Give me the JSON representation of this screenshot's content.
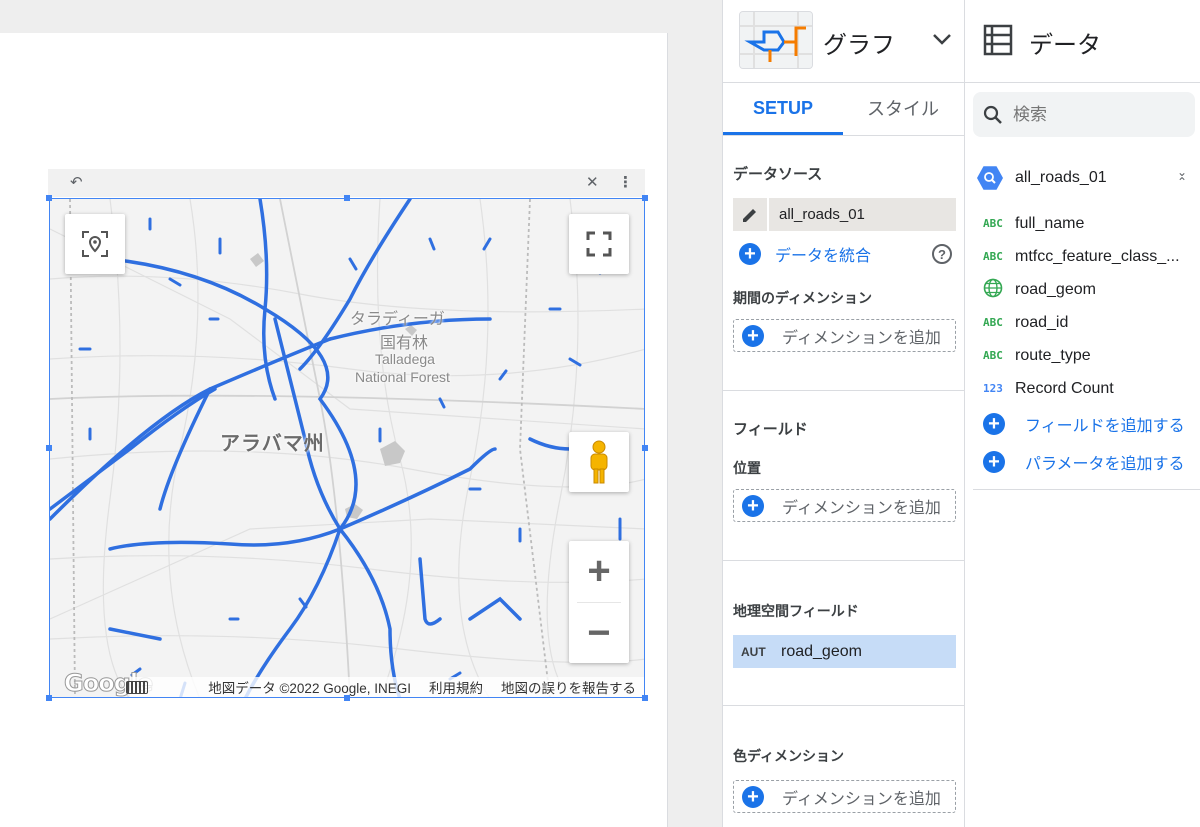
{
  "props_panel": {
    "title": "グラフ",
    "tabs": [
      {
        "label": "SETUP",
        "active": true
      },
      {
        "label": "スタイル",
        "active": false
      }
    ],
    "data_source": {
      "heading": "データソース",
      "name": "all_roads_01",
      "blend_label": "データを統合"
    },
    "date_dimension": {
      "heading": "期間のディメンション",
      "add_label": "ディメンションを追加"
    },
    "fields": {
      "heading": "フィールド",
      "location_label": "位置",
      "add_label": "ディメンションを追加"
    },
    "geo_field": {
      "heading": "地理空間フィールド",
      "type_badge": "AUT",
      "value": "road_geom"
    },
    "color_dimension": {
      "heading": "色ディメンション",
      "add_label": "ディメンションを追加"
    }
  },
  "data_panel": {
    "title": "データ",
    "search_placeholder": "検索",
    "source_name": "all_roads_01",
    "fields": [
      {
        "type": "ABC",
        "name": "full_name"
      },
      {
        "type": "ABC",
        "name": "mtfcc_feature_class_..."
      },
      {
        "type": "globe",
        "name": "road_geom"
      },
      {
        "type": "ABC",
        "name": "road_id"
      },
      {
        "type": "ABC",
        "name": "route_type"
      },
      {
        "type": "123",
        "name": "Record Count"
      }
    ],
    "add_field_label": "フィールドを追加する",
    "add_param_label": "パラメータを追加する"
  },
  "map": {
    "state_label": "アラバマ州",
    "forest_label_jp1": "タラディーガ",
    "forest_label_jp2": "国有林",
    "forest_label_en1": "Talladega",
    "forest_label_en2": "National Forest",
    "logo_text": "Google",
    "attribution": "地図データ ©2022 Google, INEGI",
    "terms_label": "利用規約",
    "report_label": "地図の誤りを報告する",
    "zoom_in": "+",
    "zoom_out": "−"
  },
  "colors": {
    "accent": "#1a73e8",
    "road": "#2f6fe0",
    "selected_geo_bg": "#c6dcf7"
  }
}
